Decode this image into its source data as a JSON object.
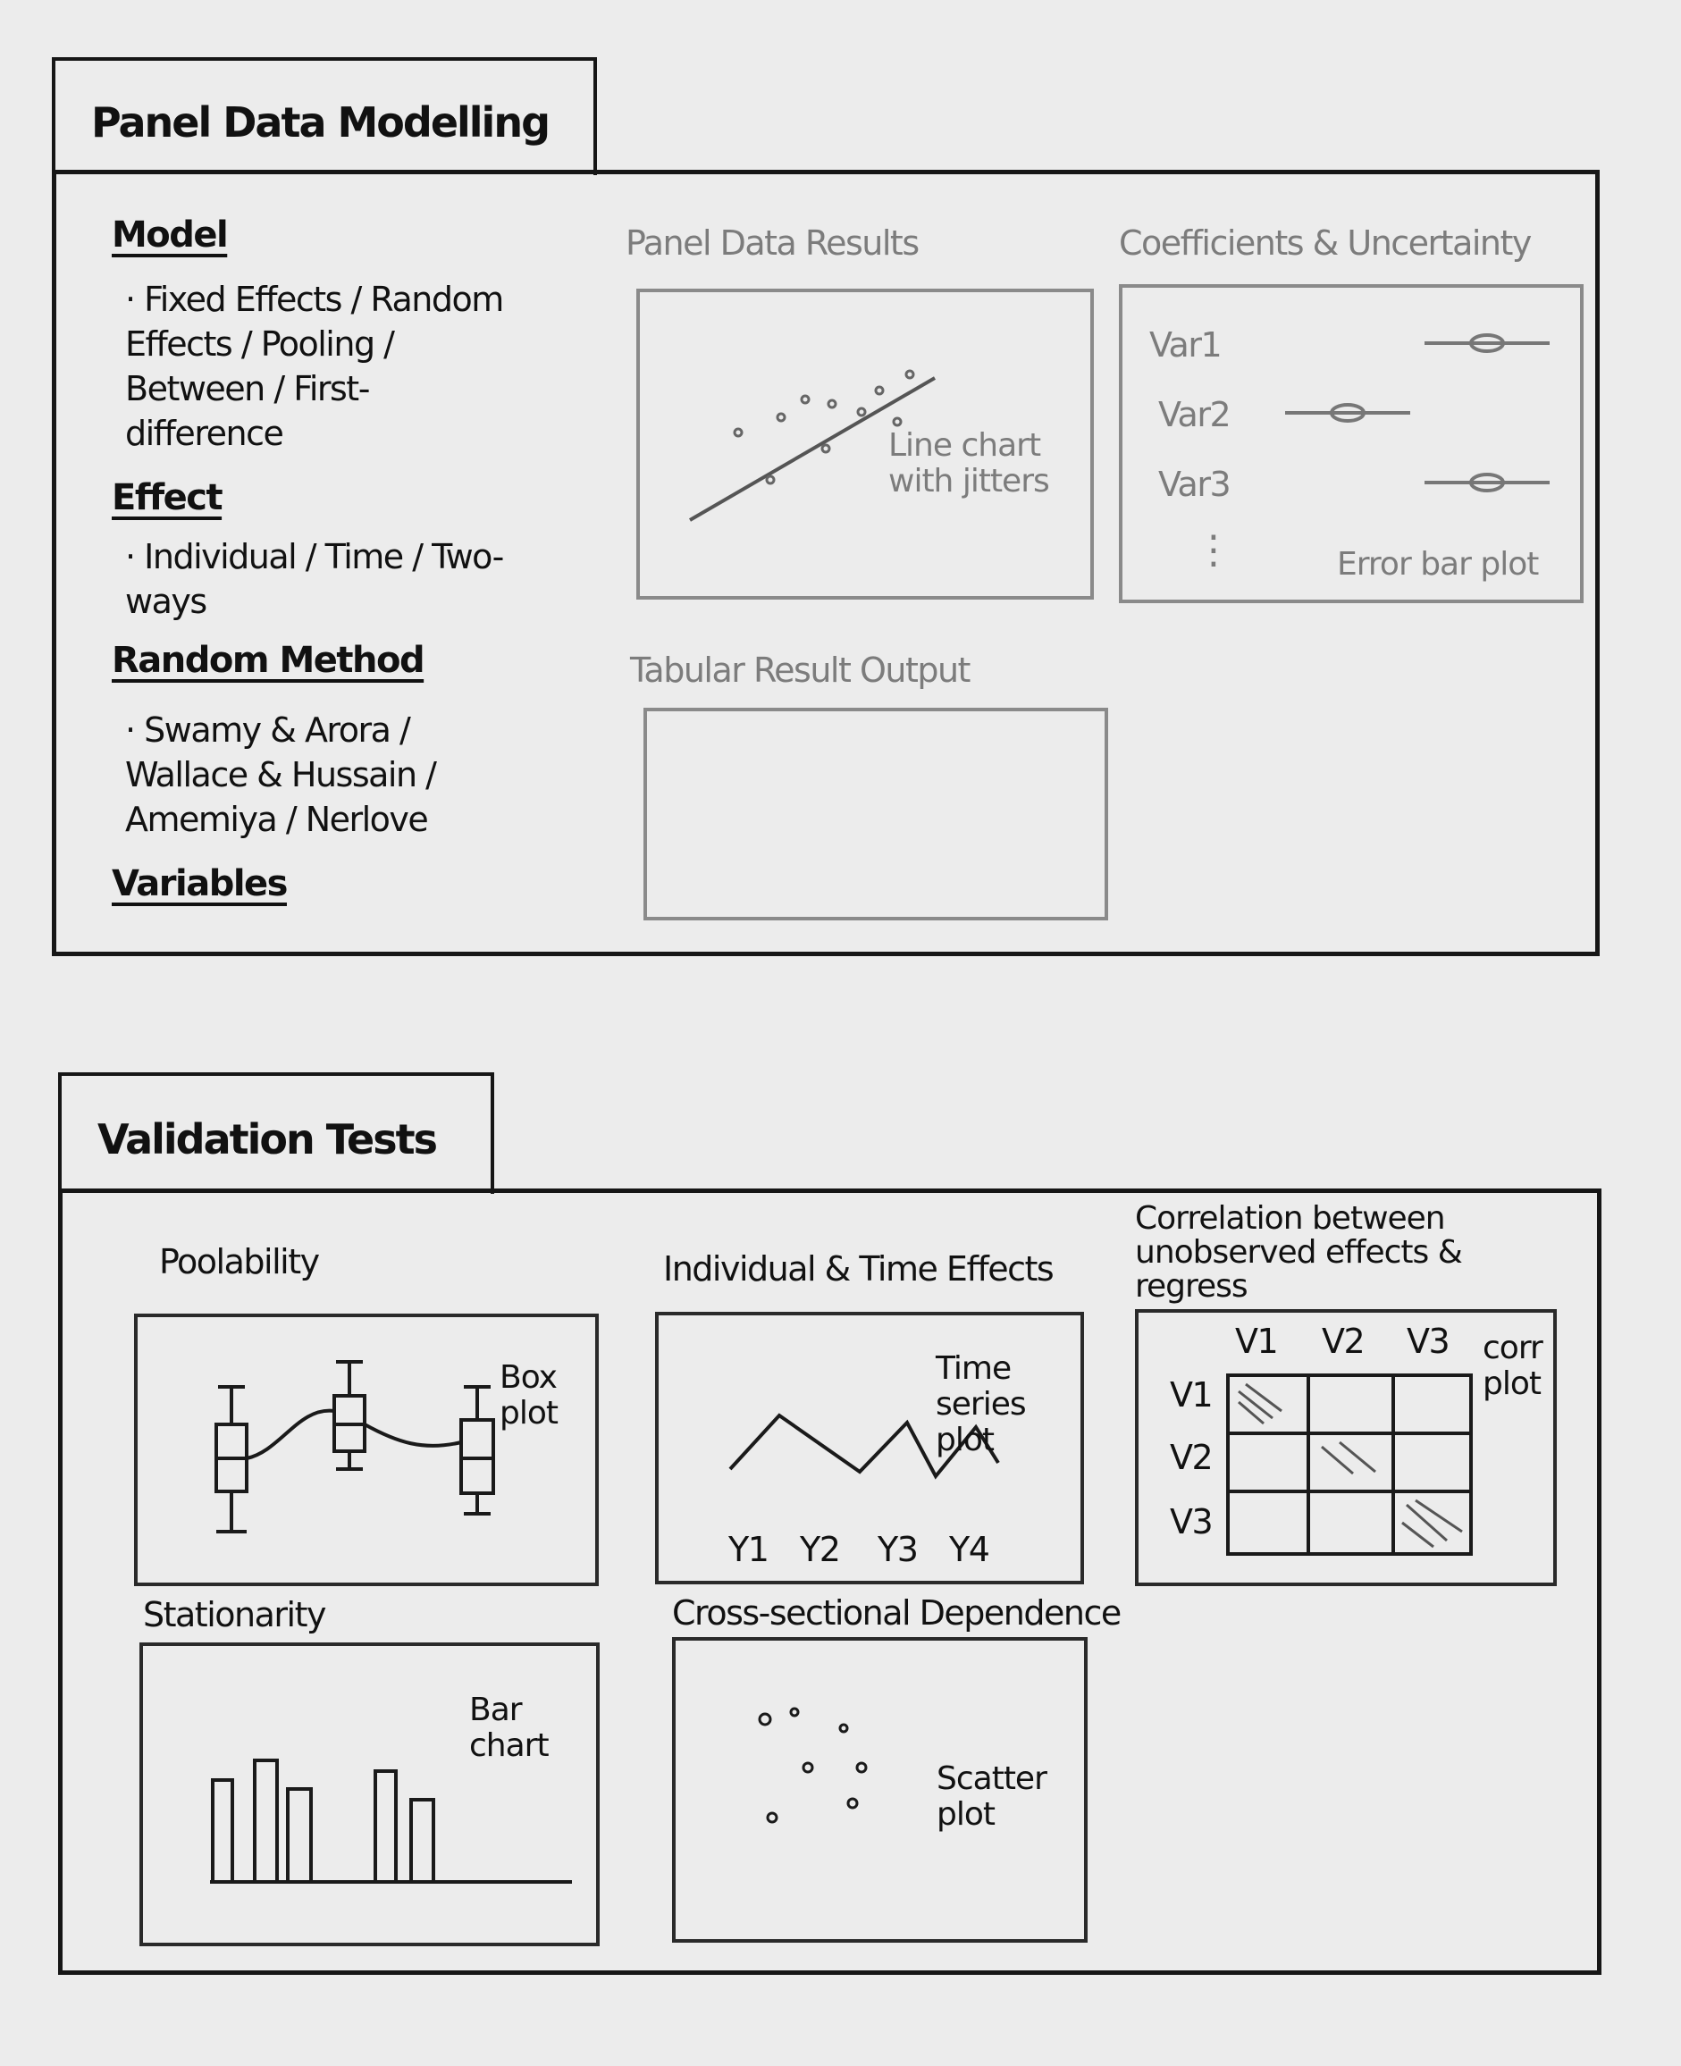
{
  "panel_modelling": {
    "tab_title": "Panel Data Modelling",
    "sidebar": {
      "model": {
        "heading": "Model",
        "options": "· Fixed Effects / Random Effects / Pooling / Between / First-difference"
      },
      "effect": {
        "heading": "Effect",
        "options": "· Individual / Time / Two-ways"
      },
      "random_method": {
        "heading": "Random Method",
        "options": "· Swamy & Arora / Wallace & Hussain / Amemiya / Nerlove"
      },
      "variables": {
        "heading": "Variables"
      }
    },
    "results_chart": {
      "title": "Panel Data Results",
      "note": "Line chart with jitters"
    },
    "coefficients_chart": {
      "title": "Coefficients & Uncertainty",
      "rows": [
        "Var1",
        "Var2",
        "Var3"
      ],
      "more": "⋮",
      "note": "Error bar plot"
    },
    "tabular": {
      "title": "Tabular Result Output"
    }
  },
  "validation_tests": {
    "tab_title": "Validation Tests",
    "poolability": {
      "title": "Poolability",
      "note": "Box plot"
    },
    "effects": {
      "title": "Individual & Time Effects",
      "note": "Time series plot",
      "xlabels": [
        "Y1",
        "Y2",
        "Y3",
        "Y4"
      ]
    },
    "correlation": {
      "title": "Correlation between unobserved effects & regress",
      "columns": [
        "V1",
        "V2",
        "V3"
      ],
      "rows": [
        "V1",
        "V2",
        "V3"
      ],
      "note": "corr plot"
    },
    "stationarity": {
      "title": "Stationarity",
      "note": "Bar chart"
    },
    "cross_sectional": {
      "title": "Cross-sectional Dependence",
      "note": "Scatter plot"
    }
  }
}
